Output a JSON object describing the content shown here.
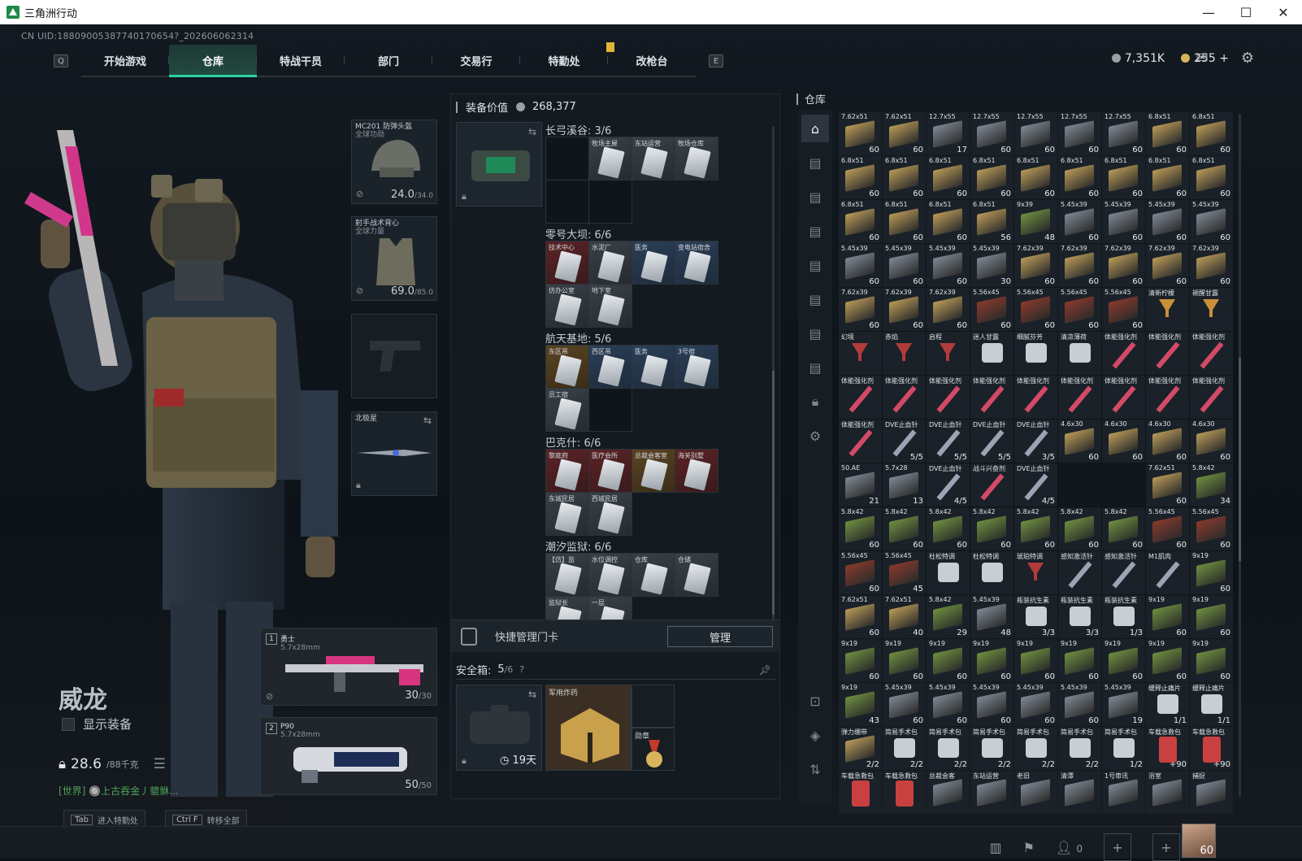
{
  "window": {
    "title": "三角洲行动",
    "minimize": "—",
    "maximize": "☐",
    "close": "✕"
  },
  "uid": "CN UID:18809005387740170654?_202606062314",
  "nav": {
    "key_left": "Q",
    "key_right": "E",
    "tabs": [
      "开始游戏",
      "仓库",
      "特战干员",
      "部门",
      "交易行",
      "特勤处",
      "改枪台"
    ],
    "active": "仓库"
  },
  "currency": {
    "silver": "7,351K",
    "gold": "255",
    "add": "+"
  },
  "operator": {
    "name": "威龙",
    "show_gear": "显示装备",
    "weight": "28.6",
    "weight_max": "/88千克",
    "world_chat": "[世界] 🔘上古吞金丿貔貅..."
  },
  "bottom_keys": [
    {
      "key": "Tab",
      "label": "进入特勤处"
    },
    {
      "key": "Ctrl F",
      "label": "转移全部"
    }
  ],
  "gear": {
    "helmet": {
      "name": "MC201 防弹头盔",
      "sub": "全球功勋",
      "dur": "24.0",
      "max": "/34.0"
    },
    "armor": {
      "name": "射手战术背心",
      "sub": "全球力量",
      "dur": "69.0",
      "max": "/85.0"
    },
    "melee": {
      "name": "北极星"
    }
  },
  "weapons": [
    {
      "slot": "1",
      "name": "勇士",
      "sub": "5.7x28mm",
      "ammo": "30",
      "max": "/30"
    },
    {
      "slot": "2",
      "name": "P90",
      "sub": "5.7x28mm",
      "ammo": "50",
      "max": "/50"
    }
  ],
  "equipment": {
    "title": "装备价值",
    "value": "268,377",
    "groups": [
      {
        "name": "长弓溪谷: 3/6",
        "cells": [
          [
            "",
            "empty"
          ],
          [
            "牧场主屋",
            "gray"
          ],
          [
            "东站运营",
            "gray"
          ],
          [
            "牧场仓库",
            "gray"
          ],
          [
            "",
            "empty"
          ],
          [
            "",
            "empty"
          ]
        ]
      },
      {
        "name": "零号大坝: 6/6",
        "cells": [
          [
            "技术中心",
            "red"
          ],
          [
            "水泥厂",
            "gray"
          ],
          [
            "医务",
            "blue"
          ],
          [
            "变电站宿舍",
            "blue"
          ],
          [
            "仿办公室",
            "gray"
          ],
          [
            "地下室",
            "gray"
          ]
        ]
      },
      {
        "name": "航天基地: 5/6",
        "cells": [
          [
            "东区吊",
            "gold"
          ],
          [
            "西区吊",
            "blue"
          ],
          [
            "医务",
            "blue"
          ],
          [
            "3号宿",
            "blue"
          ],
          [
            "员工宿",
            "gray"
          ],
          [
            "",
            "empty"
          ]
        ]
      },
      {
        "name": "巴克什: 6/6",
        "cells": [
          [
            "黎庭府",
            "red"
          ],
          [
            "医疗会所",
            "red"
          ],
          [
            "总裁会客室",
            "gold"
          ],
          [
            "海关别墅",
            "red"
          ],
          [
            "东城民居",
            "gray"
          ],
          [
            "西城民居",
            "gray"
          ]
        ]
      },
      {
        "name": "潮汐监狱: 6/6",
        "cells": [
          [
            "【仿】监",
            "gray"
          ],
          [
            "水位调控",
            "gray"
          ],
          [
            "仓库",
            "gray"
          ],
          [
            "仓储",
            "gray"
          ],
          [
            "监狱长",
            "gray"
          ],
          [
            "一层",
            "gray"
          ]
        ]
      }
    ],
    "quick": "快捷管理门卡",
    "manage": "管理",
    "safe": {
      "label": "安全箱:",
      "count": "5",
      "max": "/6",
      "help": "?",
      "timer": "19天",
      "item1": "军用炸药",
      "item2": "勋章"
    }
  },
  "warehouse": {
    "title": "仓库",
    "colors": {
      "ammo_tan": "#b89a57",
      "ammo_green": "#6d8f3f",
      "ammo_red": "#8a3a2c",
      "ammo_gray": "#7d8893",
      "drink": "#c9903a",
      "syringe": "#d24a67",
      "med": "#c94040"
    },
    "items": [
      [
        "7.62x51",
        "60",
        "t"
      ],
      [
        "7.62x51",
        "60",
        "t"
      ],
      [
        "12.7x55",
        "17",
        "g"
      ],
      [
        "12.7x55",
        "60",
        "g"
      ],
      [
        "12.7x55",
        "60",
        "g"
      ],
      [
        "12.7x55",
        "60",
        "g"
      ],
      [
        "12.7x55",
        "60",
        "g"
      ],
      [
        "6.8x51",
        "60",
        "t"
      ],
      [
        "6.8x51",
        "60",
        "t"
      ],
      [
        "6.8x51",
        "60",
        "t"
      ],
      [
        "6.8x51",
        "60",
        "t"
      ],
      [
        "6.8x51",
        "60",
        "t"
      ],
      [
        "6.8x51",
        "60",
        "t"
      ],
      [
        "6.8x51",
        "60",
        "t"
      ],
      [
        "6.8x51",
        "60",
        "t"
      ],
      [
        "6.8x51",
        "60",
        "t"
      ],
      [
        "6.8x51",
        "60",
        "t"
      ],
      [
        "6.8x51",
        "60",
        "t"
      ],
      [
        "6.8x51",
        "60",
        "t"
      ],
      [
        "6.8x51",
        "60",
        "t"
      ],
      [
        "6.8x51",
        "60",
        "t"
      ],
      [
        "6.8x51",
        "56",
        "t"
      ],
      [
        "9x39",
        "48",
        "n"
      ],
      [
        "5.45x39",
        "60",
        "g"
      ],
      [
        "5.45x39",
        "60",
        "g"
      ],
      [
        "5.45x39",
        "60",
        "g"
      ],
      [
        "5.45x39",
        "60",
        "g"
      ],
      [
        "5.45x39",
        "60",
        "g"
      ],
      [
        "5.45x39",
        "60",
        "g"
      ],
      [
        "5.45x39",
        "60",
        "g"
      ],
      [
        "5.45x39",
        "30",
        "g"
      ],
      [
        "7.62x39",
        "60",
        "t"
      ],
      [
        "7.62x39",
        "60",
        "t"
      ],
      [
        "7.62x39",
        "60",
        "t"
      ],
      [
        "7.62x39",
        "60",
        "t"
      ],
      [
        "7.62x39",
        "60",
        "t"
      ],
      [
        "7.62x39",
        "60",
        "t"
      ],
      [
        "7.62x39",
        "60",
        "t"
      ],
      [
        "7.62x39",
        "60",
        "t"
      ],
      [
        "5.56x45",
        "60",
        "r"
      ],
      [
        "5.56x45",
        "60",
        "r"
      ],
      [
        "5.56x45",
        "60",
        "r"
      ],
      [
        "5.56x45",
        "60",
        "r"
      ],
      [
        "清新柠檬",
        "",
        "d"
      ],
      [
        "褪醒甘露",
        "",
        "d"
      ],
      [
        "幻境",
        "",
        "c"
      ],
      [
        "赤焰",
        "",
        "c"
      ],
      [
        "启程",
        "",
        "c"
      ],
      [
        "迷人甘露",
        "",
        "w"
      ],
      [
        "细腻芬芳",
        "",
        "w"
      ],
      [
        "清凉薄荷",
        "",
        "w"
      ],
      [
        "体能强化剂",
        "",
        "s"
      ],
      [
        "体能强化剂",
        "",
        "s"
      ],
      [
        "体能强化剂",
        "",
        "s"
      ],
      [
        "体能强化剂",
        "",
        "s"
      ],
      [
        "体能强化剂",
        "",
        "s"
      ],
      [
        "体能强化剂",
        "",
        "s"
      ],
      [
        "体能强化剂",
        "",
        "s"
      ],
      [
        "体能强化剂",
        "",
        "s"
      ],
      [
        "体能强化剂",
        "",
        "s"
      ],
      [
        "体能强化剂",
        "",
        "s"
      ],
      [
        "体能强化剂",
        "",
        "s"
      ],
      [
        "体能强化剂",
        "",
        "s"
      ],
      [
        "体能强化剂",
        "",
        "s"
      ],
      [
        "DVE止血针",
        "5/5",
        "v"
      ],
      [
        "DVE止血针",
        "5/5",
        "v"
      ],
      [
        "DVE止血针",
        "5/5",
        "v"
      ],
      [
        "DVE止血针",
        "3/5",
        "v"
      ],
      [
        "4.6x30",
        "60",
        "t"
      ],
      [
        "4.6x30",
        "60",
        "t"
      ],
      [
        "4.6x30",
        "60",
        "t"
      ],
      [
        "4.6x30",
        "60",
        "t"
      ],
      [
        "50.AE",
        "21",
        "g"
      ],
      [
        "5.7x28",
        "13",
        "g"
      ],
      [
        "DVE止血针",
        "4/5",
        "v"
      ],
      [
        "战斗兴奋剂",
        "",
        "s"
      ],
      [
        "DVE止血针",
        "4/5",
        "v"
      ],
      [
        "",
        "",
        "e"
      ],
      [
        "",
        "",
        "e"
      ],
      [
        "7.62x51",
        "60",
        "t"
      ],
      [
        "5.8x42",
        "34",
        "n"
      ],
      [
        "5.8x42",
        "60",
        "n"
      ],
      [
        "5.8x42",
        "60",
        "n"
      ],
      [
        "5.8x42",
        "60",
        "n"
      ],
      [
        "5.8x42",
        "60",
        "n"
      ],
      [
        "5.8x42",
        "60",
        "n"
      ],
      [
        "5.8x42",
        "60",
        "n"
      ],
      [
        "5.8x42",
        "60",
        "n"
      ],
      [
        "5.56x45",
        "60",
        "r"
      ],
      [
        "5.56x45",
        "60",
        "r"
      ],
      [
        "5.56x45",
        "60",
        "r"
      ],
      [
        "5.56x45",
        "45",
        "r"
      ],
      [
        "杜松特调",
        "",
        "w"
      ],
      [
        "杜松特调",
        "",
        "w"
      ],
      [
        "琥珀特调",
        "",
        "c"
      ],
      [
        "感知激活针",
        "",
        "v"
      ],
      [
        "感知激活针",
        "",
        "v"
      ],
      [
        "M1肌肉",
        "",
        "v"
      ],
      [
        "9x19",
        "60",
        "n"
      ],
      [
        "7.62x51",
        "60",
        "t"
      ],
      [
        "7.62x51",
        "40",
        "t"
      ],
      [
        "5.8x42",
        "29",
        "n"
      ],
      [
        "5.45x39",
        "48",
        "g"
      ],
      [
        "瓶装抗生素",
        "3/3",
        "w"
      ],
      [
        "瓶装抗生素",
        "3/3",
        "w"
      ],
      [
        "瓶装抗生素",
        "1/3",
        "w"
      ],
      [
        "9x19",
        "60",
        "n"
      ],
      [
        "9x19",
        "60",
        "n"
      ],
      [
        "9x19",
        "60",
        "n"
      ],
      [
        "9x19",
        "60",
        "n"
      ],
      [
        "9x19",
        "60",
        "n"
      ],
      [
        "9x19",
        "60",
        "n"
      ],
      [
        "9x19",
        "60",
        "n"
      ],
      [
        "9x19",
        "60",
        "n"
      ],
      [
        "9x19",
        "60",
        "n"
      ],
      [
        "9x19",
        "60",
        "n"
      ],
      [
        "9x19",
        "60",
        "n"
      ],
      [
        "9x19",
        "43",
        "n"
      ],
      [
        "5.45x39",
        "60",
        "g"
      ],
      [
        "5.45x39",
        "60",
        "g"
      ],
      [
        "5.45x39",
        "60",
        "g"
      ],
      [
        "5.45x39",
        "60",
        "g"
      ],
      [
        "5.45x39",
        "60",
        "g"
      ],
      [
        "5.45x39",
        "19",
        "g"
      ],
      [
        "缓释止痛片",
        "1/1",
        "w"
      ],
      [
        "缓释止痛片",
        "1/1",
        "w"
      ],
      [
        "弹力绷带",
        "2/2",
        "t"
      ],
      [
        "简易手术包",
        "2/2",
        "w"
      ],
      [
        "简易手术包",
        "2/2",
        "w"
      ],
      [
        "简易手术包",
        "2/2",
        "w"
      ],
      [
        "简易手术包",
        "2/2",
        "w"
      ],
      [
        "简易手术包",
        "2/2",
        "w"
      ],
      [
        "简易手术包",
        "1/2",
        "w"
      ],
      [
        "车载急救包",
        "+90",
        "m"
      ],
      [
        "车载急救包",
        "+90",
        "m"
      ],
      [
        "车载急救包",
        "",
        "m"
      ],
      [
        "车载急救包",
        "",
        "m"
      ],
      [
        "总裁会客",
        "",
        "g"
      ],
      [
        "东站运营",
        "",
        "g"
      ],
      [
        "老旧",
        "",
        "g"
      ],
      [
        "清潭",
        "",
        "g"
      ],
      [
        "1号审讯",
        "",
        "g"
      ],
      [
        "浴室",
        "",
        "g"
      ],
      [
        "捕捉",
        "",
        "g"
      ]
    ]
  },
  "footer": {
    "friends": "0",
    "level": "60"
  }
}
